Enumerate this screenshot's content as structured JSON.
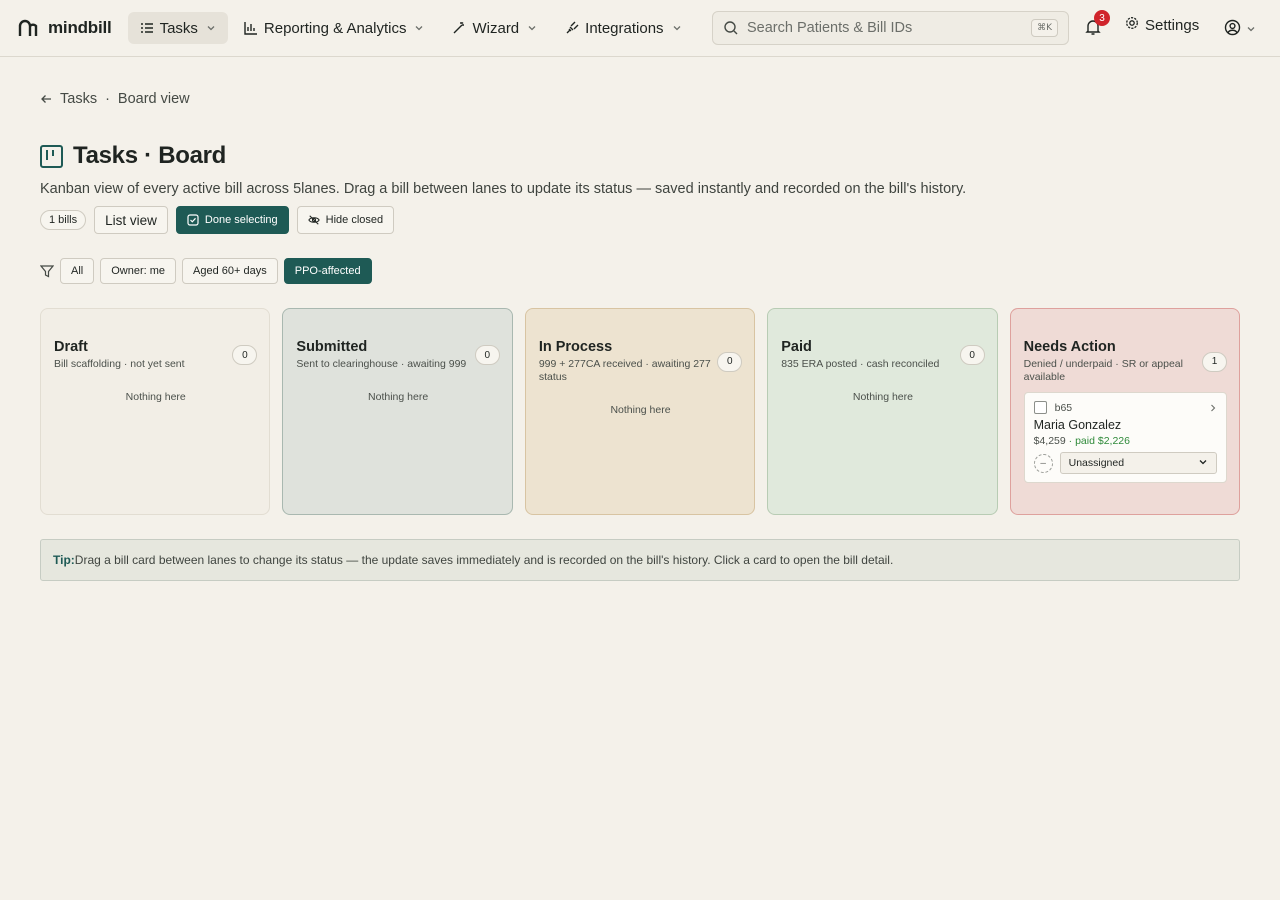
{
  "nav": {
    "brand": "mindbill",
    "items": [
      {
        "label": "Tasks",
        "icon": "list-icon"
      },
      {
        "label": "Reporting & Analytics",
        "icon": "chart-icon"
      },
      {
        "label": "Wizard",
        "icon": "wand-icon"
      },
      {
        "label": "Integrations",
        "icon": "plug-icon"
      }
    ],
    "search_placeholder": "Search Patients & Bill IDs",
    "search_shortcut": "⌘K",
    "notification_count": "3",
    "settings_label": "Settings"
  },
  "breadcrumb": {
    "back": "Tasks",
    "separator": "·",
    "current": "Board view"
  },
  "page": {
    "title": "Tasks · Board",
    "subtitle": "Kanban view of every active bill across 5lanes. Drag a bill between lanes to update its status — saved instantly and recorded on the bill's history."
  },
  "actions": {
    "count": "1 bills",
    "list_view": "List view",
    "done_selecting": "Done selecting",
    "hide_closed": "Hide closed"
  },
  "filters": [
    "All",
    "Owner: me",
    "Aged 60+ days",
    "PPO-affected"
  ],
  "lanes": [
    {
      "title": "Draft",
      "desc": "Bill scaffolding · not yet sent",
      "count": "0",
      "empty": "Nothing here"
    },
    {
      "title": "Submitted",
      "desc": "Sent to clearinghouse · awaiting 999",
      "count": "0",
      "empty": "Nothing here"
    },
    {
      "title": "In Process",
      "desc": "999 + 277CA received · awaiting 277 status",
      "count": "0",
      "empty": "Nothing here"
    },
    {
      "title": "Paid",
      "desc": "835 ERA posted · cash reconciled",
      "count": "0",
      "empty": "Nothing here"
    },
    {
      "title": "Needs Action",
      "desc": "Denied / underpaid · SR or appeal available",
      "count": "1"
    }
  ],
  "card": {
    "id": "b65",
    "name": "Maria Gonzalez",
    "amount": "$4,259",
    "paid": "· paid $2,226",
    "assignee_placeholder": "–",
    "assignee": "Unassigned"
  },
  "tip": {
    "label": "Tip:",
    "text": "Drag a bill card between lanes to change its status — the update saves immediately and is recorded on the bill's history. Click a card to open the bill detail."
  }
}
